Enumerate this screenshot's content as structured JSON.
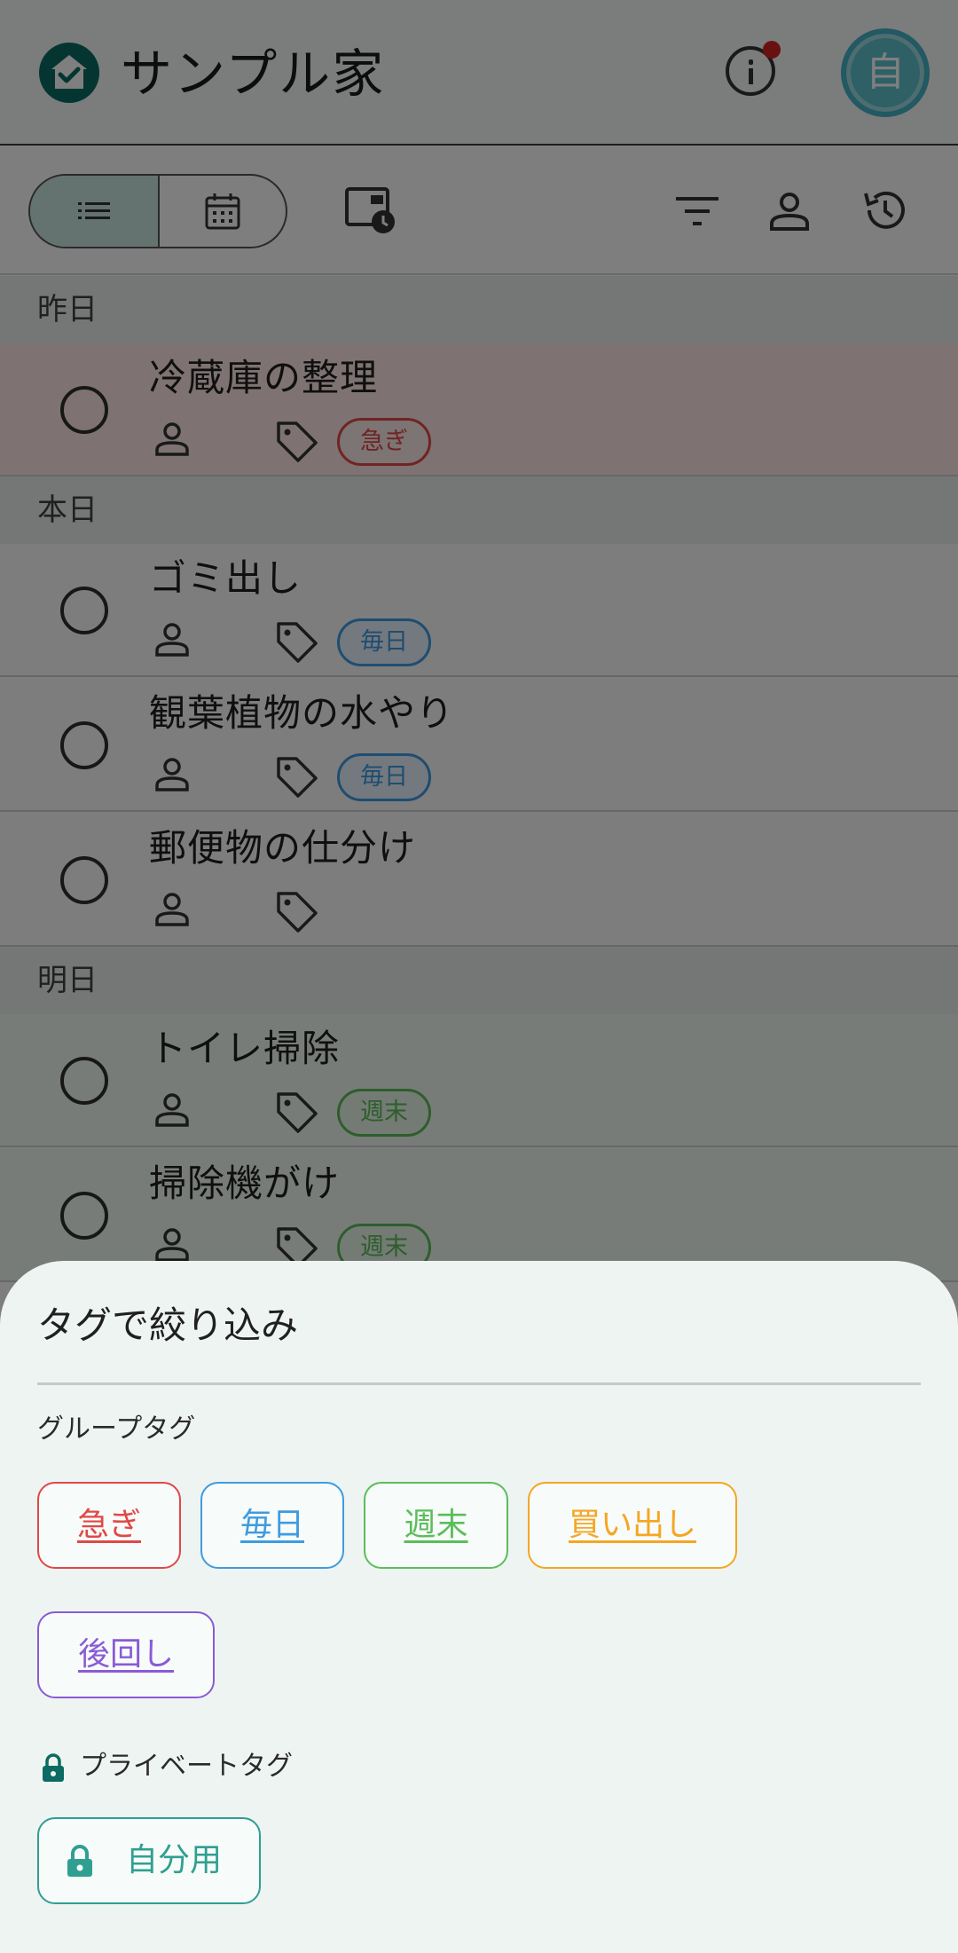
{
  "header": {
    "title": "サンプル家",
    "avatar_initial": "自"
  },
  "toolbar": {
    "view_mode": "list",
    "icons": [
      "list-icon",
      "calendar-icon",
      "scheduled-icon",
      "filter-icon",
      "person-icon",
      "history-icon"
    ]
  },
  "sections": {
    "yesterday": {
      "label": "昨日",
      "tasks": [
        {
          "title": "冷蔵庫の整理",
          "tag": "急ぎ"
        }
      ]
    },
    "today": {
      "label": "本日",
      "tasks": [
        {
          "title": "ゴミ出し",
          "tag": "毎日"
        },
        {
          "title": "観葉植物の水やり",
          "tag": "毎日"
        },
        {
          "title": "郵便物の仕分け",
          "tag": ""
        }
      ]
    },
    "tomorrow": {
      "label": "明日",
      "tasks": [
        {
          "title": "トイレ掃除",
          "tag": "週末"
        },
        {
          "title": "掃除機がけ",
          "tag": "週末"
        }
      ]
    }
  },
  "filter_sheet": {
    "title": "タグで絞り込み",
    "group_tags_label": "グループタグ",
    "group_tags": [
      {
        "label": "急ぎ",
        "color": "#e04848"
      },
      {
        "label": "毎日",
        "color": "#3f9be0"
      },
      {
        "label": "週末",
        "color": "#5bbd5b"
      },
      {
        "label": "買い出し",
        "color": "#f5a623"
      },
      {
        "label": "後回し",
        "color": "#8a5bd6"
      }
    ],
    "private_tags_label": "プライベートタグ",
    "private_tags": [
      {
        "label": "自分用",
        "color": "#2f9f92"
      }
    ]
  },
  "colors": {
    "accent": "#0b6b62",
    "urgent": "#e04848",
    "daily": "#3f9be0",
    "weekend": "#5bbd5b"
  }
}
